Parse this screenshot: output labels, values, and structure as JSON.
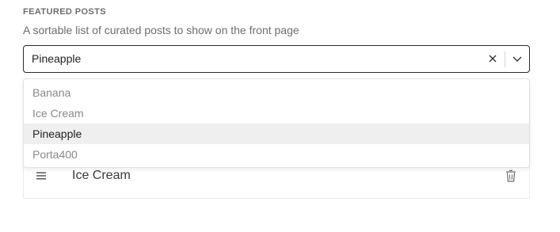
{
  "field": {
    "title": "FEATURED POSTS",
    "description": "A sortable list of curated posts to show on the front page"
  },
  "select": {
    "value": "Pineapple",
    "options": [
      {
        "label": "Banana",
        "selected": false
      },
      {
        "label": "Ice Cream",
        "selected": false
      },
      {
        "label": "Pineapple",
        "selected": true
      },
      {
        "label": "Porta400",
        "selected": false
      }
    ]
  },
  "list": {
    "items": [
      {
        "label": "Ice Cream"
      }
    ]
  },
  "icons": {
    "clear": "close-icon",
    "open": "chevron-down-icon",
    "drag": "drag-handle-icon",
    "delete": "trash-icon"
  },
  "colors": {
    "text_primary": "#1f1f1f",
    "text_muted": "#6e6e73",
    "selected_bg": "#efefef",
    "border_focus": "#2b2b2b"
  }
}
